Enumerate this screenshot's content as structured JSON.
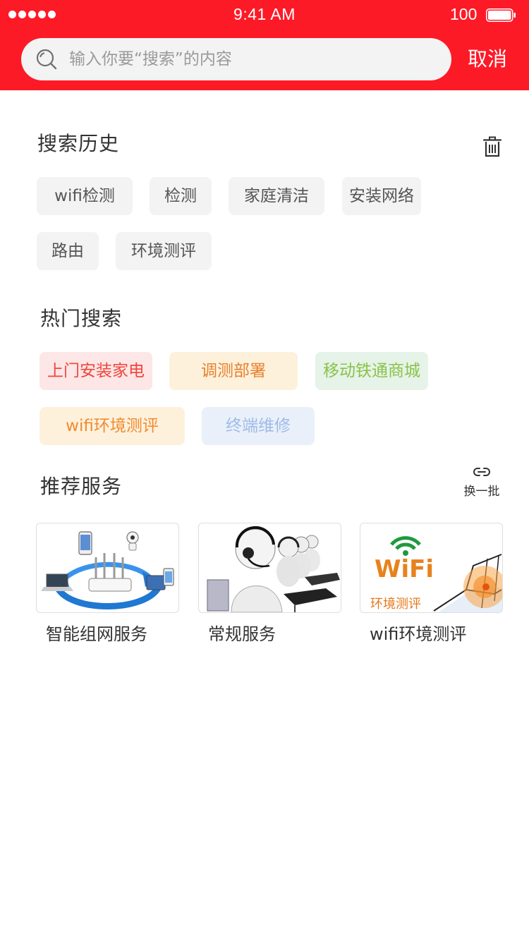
{
  "status_bar": {
    "time": "9:41 AM",
    "battery": "100"
  },
  "search": {
    "placeholder": "输入你要“搜索”的内容",
    "cancel": "取消"
  },
  "history": {
    "title": "搜索历史",
    "tags": [
      "wifi检测",
      "检测",
      "家庭清洁",
      "安装网络",
      "路由",
      "环境测评"
    ]
  },
  "hot": {
    "title": "热门搜索",
    "tags": [
      {
        "label": "上门安装家电",
        "color": "#f0453d",
        "bg": "#fde6e6"
      },
      {
        "label": "调测部署",
        "color": "#e8812f",
        "bg": "#fdf1dc"
      },
      {
        "label": "移动铁通商城",
        "color": "#8ac34a",
        "bg": "#e6f3e8"
      },
      {
        "label": "wifi环境测评",
        "color": "#f08b2f",
        "bg": "#fdf1dc"
      },
      {
        "label": "终端维修",
        "color": "#9fbbe9",
        "bg": "#eaf0f9"
      }
    ]
  },
  "recommend": {
    "title": "推荐服务",
    "refresh": "换一批",
    "cards": [
      {
        "title": "智能组网服务"
      },
      {
        "title": "常规服务"
      },
      {
        "title": "wifi环境测评",
        "logo_text": "WiFi",
        "subtitle": "环境测评"
      }
    ]
  },
  "colors": {
    "brand": "#fd1a27"
  }
}
